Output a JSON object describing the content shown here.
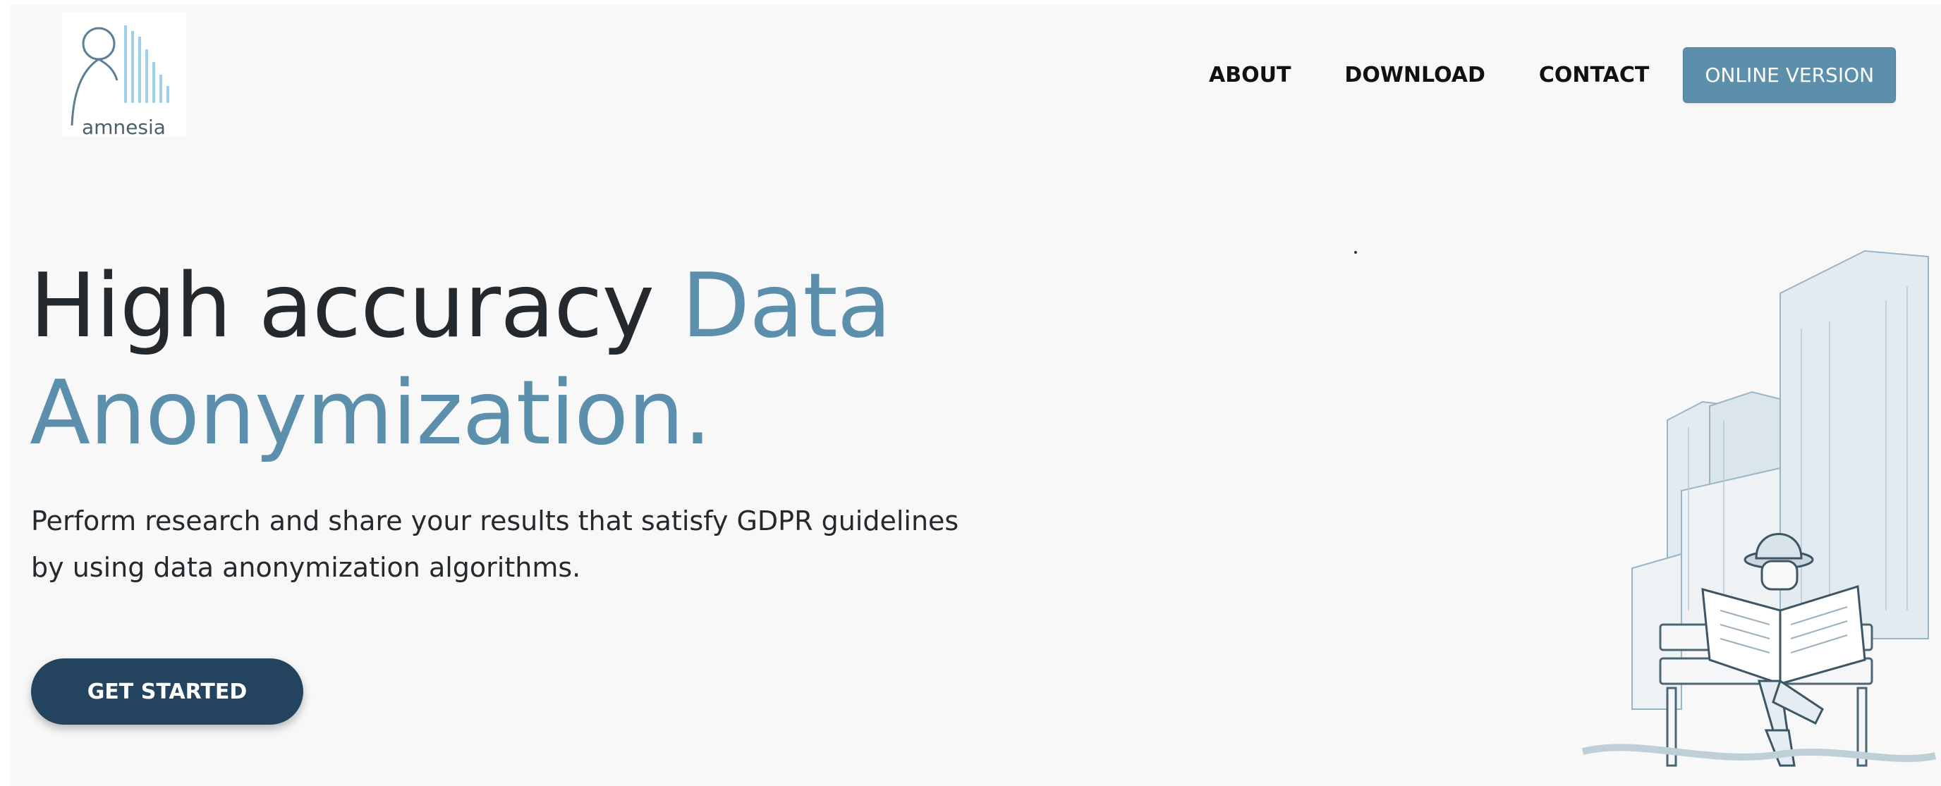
{
  "header": {
    "logo_text": "amnesia",
    "nav": [
      {
        "label": "ABOUT"
      },
      {
        "label": "DOWNLOAD"
      },
      {
        "label": "CONTACT"
      }
    ],
    "online_button": "ONLINE VERSION"
  },
  "hero": {
    "headline_part1": "High accuracy ",
    "headline_accent_line1": "Data",
    "headline_accent_line2": "Anonymization.",
    "subtext_line1": "Perform research and share your results that satisfy GDPR guidelines",
    "subtext_line2": "by using data anonymization algorithms.",
    "cta_label": "GET STARTED"
  },
  "colors": {
    "accent": "#5b8fab",
    "cta": "#23435e",
    "text": "#24292e",
    "background": "#f8f8f8"
  },
  "illustration": {
    "icon": "city-spy-reading-newspaper-illustration"
  }
}
